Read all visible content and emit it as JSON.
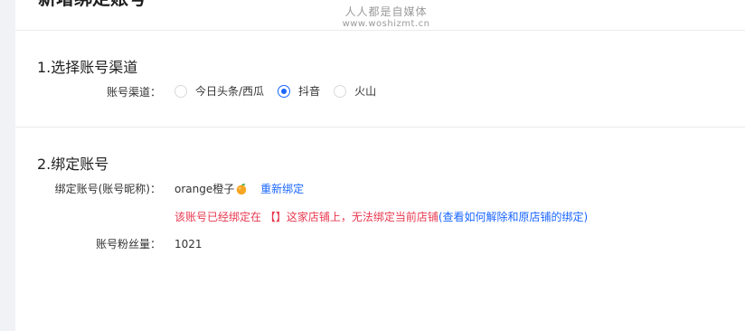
{
  "header": {
    "title": "新增绑定账号"
  },
  "watermark": {
    "line1": "人人都是自媒体",
    "line2": "www.woshizmt.cn"
  },
  "section1": {
    "title": "1.选择账号渠道",
    "channel_label": "账号渠道：",
    "options": [
      {
        "label": "今日头条/西瓜",
        "checked": false
      },
      {
        "label": "抖音",
        "checked": true
      },
      {
        "label": "火山",
        "checked": false
      }
    ]
  },
  "section2": {
    "title": "2.绑定账号",
    "account_label": "绑定账号(账号昵称)：",
    "account_name": "orange橙子",
    "account_icon": "orange-emoji-icon",
    "rebind_link": "重新绑定",
    "error_text": "该账号已经绑定在 【】这家店铺上，无法绑定当前店铺",
    "help_link": "(查看如何解除和原店铺的绑定)",
    "fans_label": "账号粉丝量：",
    "fans_count": "1021"
  },
  "colors": {
    "primary": "#1966ff",
    "error": "#e8384f",
    "text": "#333333",
    "divider": "#ebebeb"
  }
}
